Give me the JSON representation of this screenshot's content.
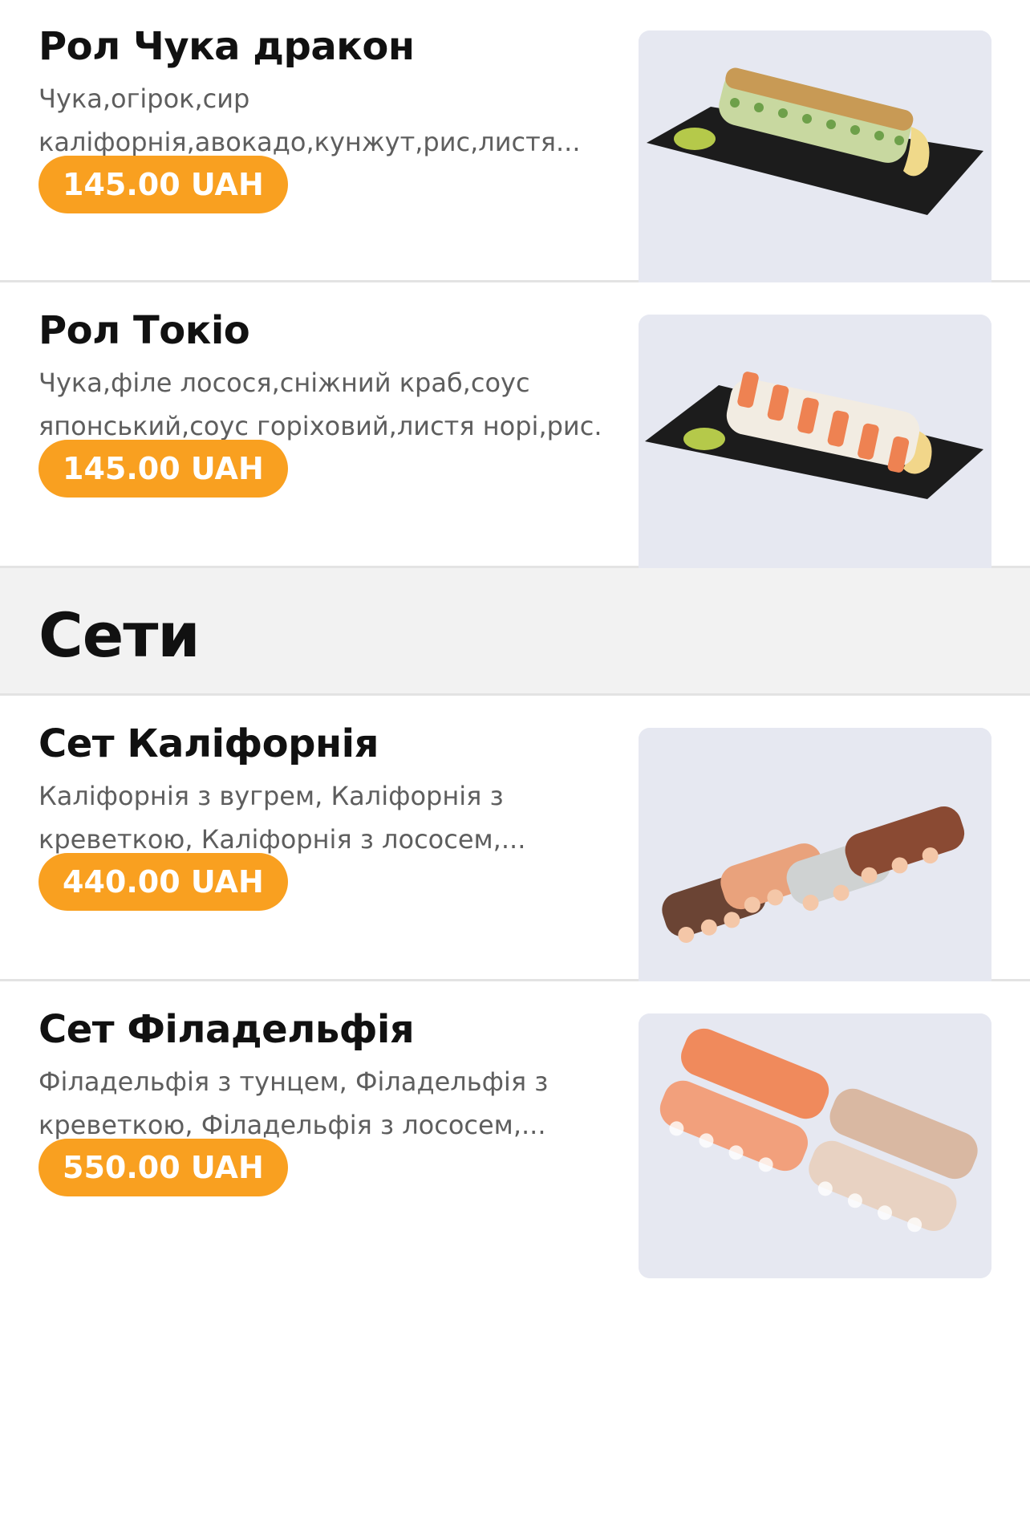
{
  "menu": {
    "items_top": [
      {
        "title": "Рол Чука дракон",
        "desc_line1": "Чука,огірок,сир",
        "desc_line2": "каліфорнія,авокадо,кунжут,рис,листя...",
        "price": "145.00 UAH",
        "photo_icon": "sushi-roll-dragon-image"
      },
      {
        "title": "Рол Токіо",
        "desc_line1": "Чука,філе лосося,сніжний краб,соус",
        "desc_line2": "японський,соус горіховий,листя норі,рис...",
        "price": "145.00 UAH",
        "photo_icon": "sushi-roll-tokyo-image"
      }
    ],
    "section": {
      "title": "Сети"
    },
    "items_sets": [
      {
        "title": "Сет Каліфорнія",
        "desc_line1": "Каліфорнія з вугрем, Каліфорнія з",
        "desc_line2": "креветкою, Каліфорнія з лососем,...",
        "price": "440.00 UAH",
        "photo_icon": "sushi-set-california-image"
      },
      {
        "title": "Сет Філадельфія",
        "desc_line1": "Філадельфія з тунцем, Філадельфія з",
        "desc_line2": "креветкою, Філадельфія з лососем,...",
        "price": "550.00 UAH",
        "photo_icon": "sushi-set-philadelphia-image"
      }
    ]
  },
  "colors": {
    "accent": "#f9a020",
    "text_primary": "#111111",
    "text_secondary": "#5e5e5e",
    "section_bg": "#f2f2f2",
    "divider": "#e3e3e3"
  }
}
